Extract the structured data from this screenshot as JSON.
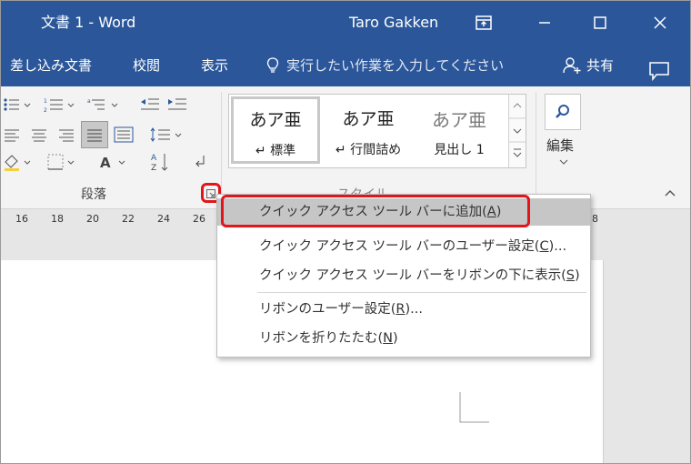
{
  "titlebar": {
    "doc_title": "文書 1 - Word",
    "user": "Taro Gakken",
    "icons": [
      "ribbon-display-icon",
      "minimize-icon",
      "maximize-icon",
      "close-icon"
    ]
  },
  "menubar": {
    "tabs": [
      "差し込み文書",
      "校閲",
      "表示"
    ],
    "tell_me": "実行したい作業を入力してください",
    "share": "共有"
  },
  "ribbon": {
    "paragraph_group": "段落",
    "styles_group": "スタイル",
    "editing_label": "編集",
    "styles": [
      {
        "sample": "あア亜",
        "name": "↵ 標準"
      },
      {
        "sample": "あア亜",
        "name": "↵ 行間詰め"
      },
      {
        "sample": "あア亜",
        "name": "見出し 1"
      }
    ]
  },
  "ruler": {
    "numbers": [
      "16",
      "18",
      "20",
      "22",
      "24",
      "26",
      "8"
    ]
  },
  "context_menu": {
    "items": [
      {
        "text": "クイック アクセス ツール バーに追加(",
        "key": "A",
        "tail": ")"
      },
      {
        "text": "クイック アクセス ツール バーのユーザー設定(",
        "key": "C",
        "tail": ")..."
      },
      {
        "text": "クイック アクセス ツール バーをリボンの下に表示(",
        "key": "S",
        "tail": ")"
      },
      {
        "text": "リボンのユーザー設定(",
        "key": "R",
        "tail": ")..."
      },
      {
        "text": "リボンを折りたたむ(",
        "key": "N",
        "tail": ")"
      }
    ]
  },
  "colors": {
    "accent": "#2b579a",
    "highlight": "#e3151b"
  }
}
